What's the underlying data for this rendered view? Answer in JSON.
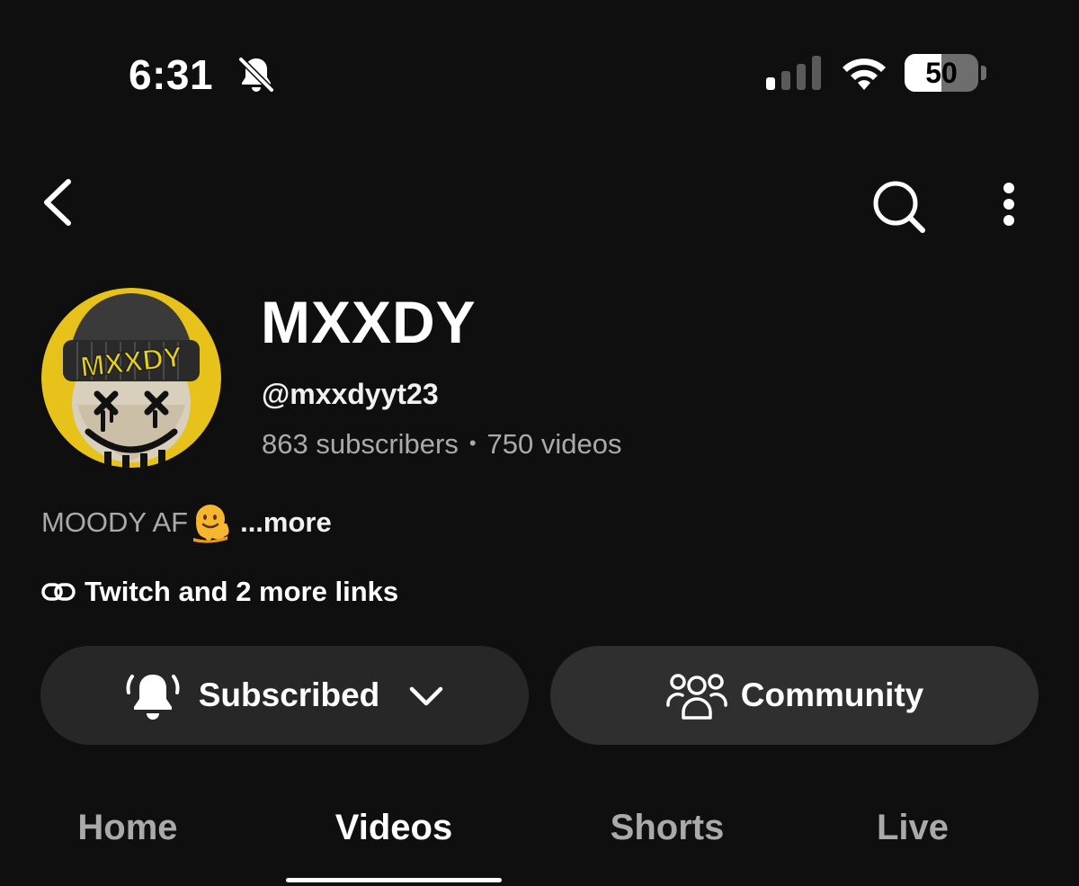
{
  "status_bar": {
    "time": "6:31",
    "battery_percent": "50",
    "battery_level": 0.5,
    "signal_bars_active": 1,
    "signal_bars_total": 4,
    "icons": [
      "bell-slash-icon",
      "cellular-signal-icon",
      "wifi-icon",
      "battery-icon"
    ]
  },
  "top_bar": {
    "icons": [
      "back-chevron-icon",
      "search-icon",
      "more-vertical-icon"
    ]
  },
  "channel": {
    "avatar_text": "MXXDY",
    "name": "MXXDY",
    "handle": "@mxxdyyt23",
    "subscribers": "863 subscribers",
    "separator": "•",
    "videos": "750 videos",
    "description": "MOODY AF",
    "description_emoji": "melting-face-emoji",
    "more_label": "...more",
    "links_label": "Twitch and 2 more links"
  },
  "actions": {
    "subscribed_label": "Subscribed",
    "community_label": "Community"
  },
  "tabs": [
    {
      "label": "Home"
    },
    {
      "label": "Videos"
    },
    {
      "label": "Shorts"
    },
    {
      "label": "Live"
    }
  ],
  "colors": {
    "background": "#0f0f0f",
    "pill": "#272727",
    "secondary_text": "#aaaaaa",
    "avatar_accent": "#e6c21a"
  }
}
